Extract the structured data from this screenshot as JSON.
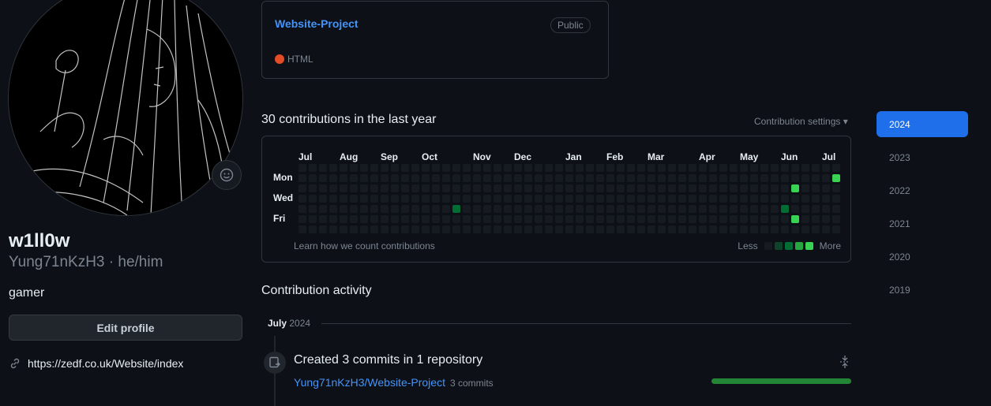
{
  "profile": {
    "display_name": "w1ll0w",
    "username_pronouns": "Yung71nKzH3 · he/him",
    "bio": "gamer",
    "edit_label": "Edit profile",
    "website": "https://zedf.co.uk/Website/index"
  },
  "pinned_repo": {
    "name": "Website-Project",
    "visibility": "Public",
    "language": "HTML",
    "language_color": "#e34c26"
  },
  "contributions": {
    "heading": "30 contributions in the last year",
    "settings_label": "Contribution settings ▾",
    "months": [
      "Jul",
      "Aug",
      "Sep",
      "Oct",
      "Nov",
      "Dec",
      "Jan",
      "Feb",
      "Mar",
      "Apr",
      "May",
      "Jun",
      "Jul"
    ],
    "days": [
      "Mon",
      "Wed",
      "Fri"
    ],
    "learn_label": "Learn how we count contributions",
    "legend_less": "Less",
    "legend_more": "More",
    "legend_colors": [
      "#161b22",
      "#0e4429",
      "#006d32",
      "#26a641",
      "#39d353"
    ],
    "active_cells": [
      {
        "week": 15,
        "day": 4,
        "level": 2
      },
      {
        "week": 47,
        "day": 4,
        "level": 2
      },
      {
        "week": 48,
        "day": 2,
        "level": 4
      },
      {
        "week": 48,
        "day": 5,
        "level": 4
      },
      {
        "week": 52,
        "day": 1,
        "level": 4
      }
    ]
  },
  "years": [
    "2024",
    "2023",
    "2022",
    "2021",
    "2020",
    "2019"
  ],
  "active_year": "2024",
  "activity": {
    "heading": "Contribution activity",
    "month": "July",
    "year": "2024",
    "commit_title": "Created 3 commits in 1 repository",
    "repo": "Yung71nKzH3/Website-Project",
    "commit_count": "3 commits"
  }
}
